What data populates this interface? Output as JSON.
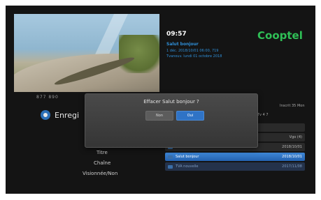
{
  "header": {
    "time": "09:57",
    "brand": "Cooptel",
    "video_caption": "877  890"
  },
  "info": {
    "title": "Salut bonjour",
    "line1": "1 déc. 2018/10/01 06:00, 719",
    "line2": "Tvanouv. lundi 01 octobre 2018"
  },
  "page": {
    "title": "Enregi",
    "right_label": "Inscrit 35 Mon",
    "sub_label": "Tv 4 7"
  },
  "fields": {
    "title_label": "Titre",
    "channel_label": "Chaîne",
    "view_label": "Visionnée/Non"
  },
  "list": {
    "rows": [
      {
        "name": "",
        "date": ""
      },
      {
        "name": "",
        "date": "Vgo (4)"
      },
      {
        "name": "Pour",
        "date": "2018/10/01"
      },
      {
        "name": "Salut bonjour",
        "date": "2018/10/01"
      },
      {
        "name": "TVA nouvelle",
        "date": "2017/11/08"
      }
    ]
  },
  "dialog": {
    "message": "Effacer Salut bonjour ?",
    "no_label": "Non",
    "yes_label": "Oui"
  },
  "colors": {
    "brand": "#2fbf56",
    "accent": "#2f8fd8",
    "selected": "#2f73c6"
  }
}
